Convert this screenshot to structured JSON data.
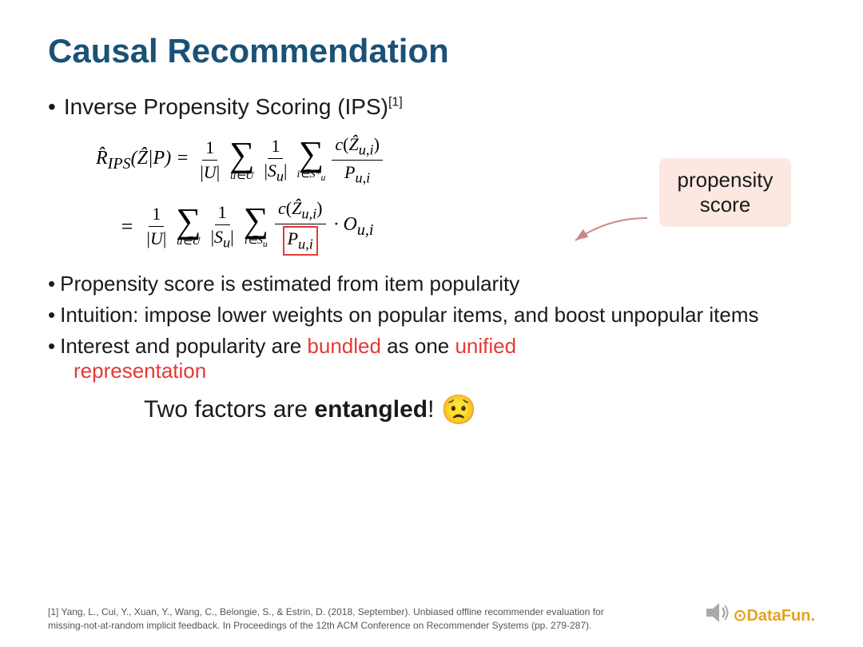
{
  "slide": {
    "title": "Causal Recommendation",
    "bullet1": {
      "text": "Inverse Propensity Scoring (IPS)",
      "superscript": "[1]"
    },
    "formula1": {
      "lhs": "R̂_IPS(Ẑ|P) =",
      "description": "First line of IPS formula"
    },
    "formula2": {
      "lhs": "=",
      "description": "Second line with propensity score highlighted"
    },
    "propensity_callout": "propensity\nscore",
    "bullets": [
      "Propensity score is estimated from item popularity",
      "Intuition: impose lower weights on popular items, and boost unpopular items",
      "Interest and popularity are bundled as one unified representation"
    ],
    "entangled_line": "Two factors are entangled!",
    "footer": {
      "citation": "[1] Yang, L., Cui, Y., Xuan, Y., Wang, C., Belongie, S., & Estrin, D. (2018, September). Unbiased offline recommender evaluation for missing-not-at-random implicit feedback. In Proceedings of the 12th ACM Conference on Recommender Systems (pp. 279-287).",
      "logo_text": "DataFun."
    }
  }
}
